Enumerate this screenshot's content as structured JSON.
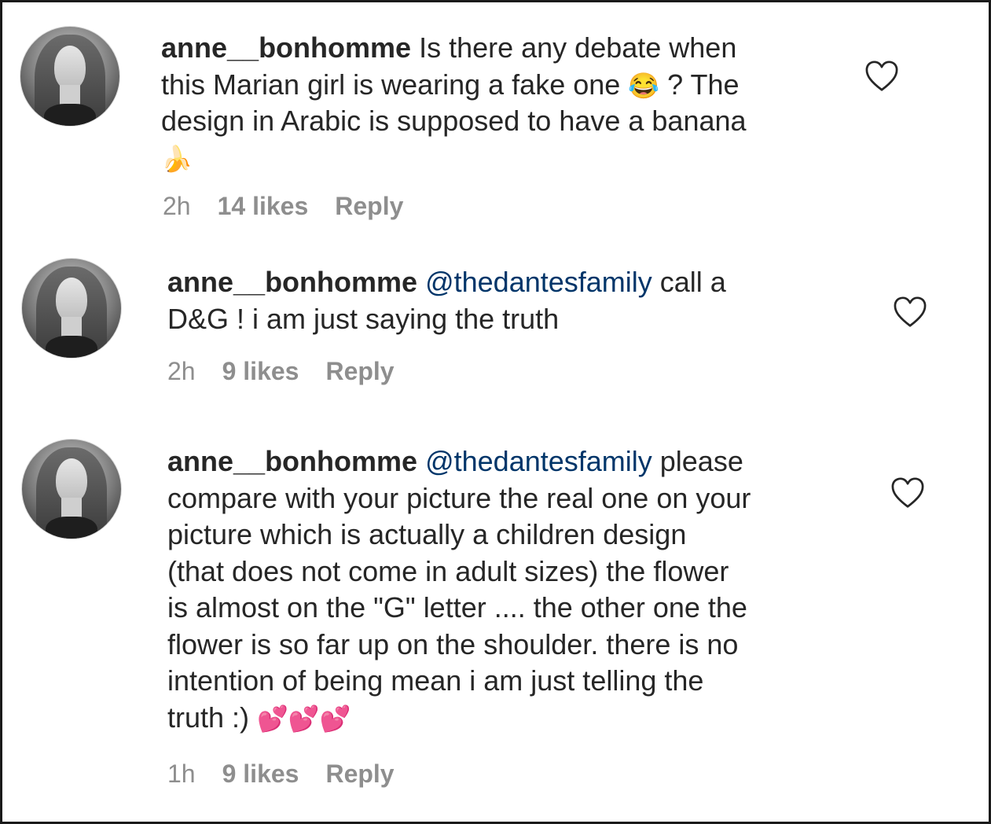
{
  "comments": [
    {
      "username": "anne__bonhomme",
      "mention": "",
      "lines": [
        " Is there any debate when",
        "this Marian girl is wearing a fake one",
        "design in Arabic is supposed to have a banana"
      ],
      "line2_suffix": " ?  The",
      "emoji_laugh": "😂",
      "emoji_banana": "🍌",
      "time": "2h",
      "likes": "14 likes",
      "reply": "Reply"
    },
    {
      "username": "anne__bonhomme",
      "mention": "@thedantesfamily",
      "lines": [
        " call a",
        "D&G ! i am just saying the truth"
      ],
      "time": "2h",
      "likes": "9 likes",
      "reply": "Reply"
    },
    {
      "username": "anne__bonhomme",
      "mention": "@thedantesfamily",
      "lines": [
        " please",
        "compare with your picture the real one on your",
        "picture which is actually a children design",
        "(that does not come in adult sizes) the flower",
        "is almost on the \"G\" letter .... the other one the",
        "flower is so far up on the shoulder. there is no",
        "intention of being mean i am just telling the",
        "truth :) "
      ],
      "emoji_hearts": "💕💕💕",
      "time": "1h",
      "likes": "9 likes",
      "reply": "Reply"
    }
  ],
  "icons": {
    "avatar": "profile-photo",
    "like": "heart-outline-icon"
  },
  "colors": {
    "text": "#262626",
    "mention": "#003569",
    "meta": "#8e8e8e",
    "heart_stroke": "#262626"
  }
}
